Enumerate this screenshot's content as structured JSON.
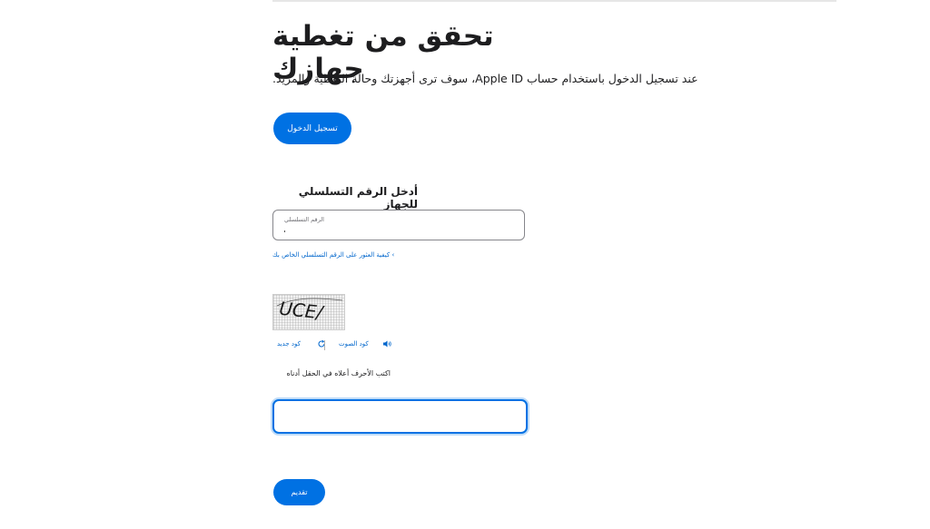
{
  "page": {
    "title": "تحقق من تغطية جهازك",
    "subtitle": ".سوف ترى أجهزتك وحالة التغطية والمزيد ،Apple ID عند تسجيل الدخول باستخدام حساب"
  },
  "signin": {
    "label": "تسجيل الدخول"
  },
  "serial": {
    "heading": "أدخل الرقم التسلسلي للجهاز",
    "field_label": "الرقم التسلسلي",
    "value": "",
    "help_link": "› كيفية العثور على الرقم التسلسلي الخاص بك"
  },
  "captcha": {
    "image_text": "UCE/",
    "audio_label": "كود الصوت",
    "new_label": "كود جديد",
    "instruction": "اكتب الأحرف أعلاه في الحقل أدناه",
    "value": ""
  },
  "submit": {
    "label": "تقديم"
  },
  "colors": {
    "accent": "#0071e3",
    "link": "#0066cc",
    "text": "#1d1d1f"
  },
  "icons": [
    "speaker-icon",
    "refresh-icon"
  ]
}
